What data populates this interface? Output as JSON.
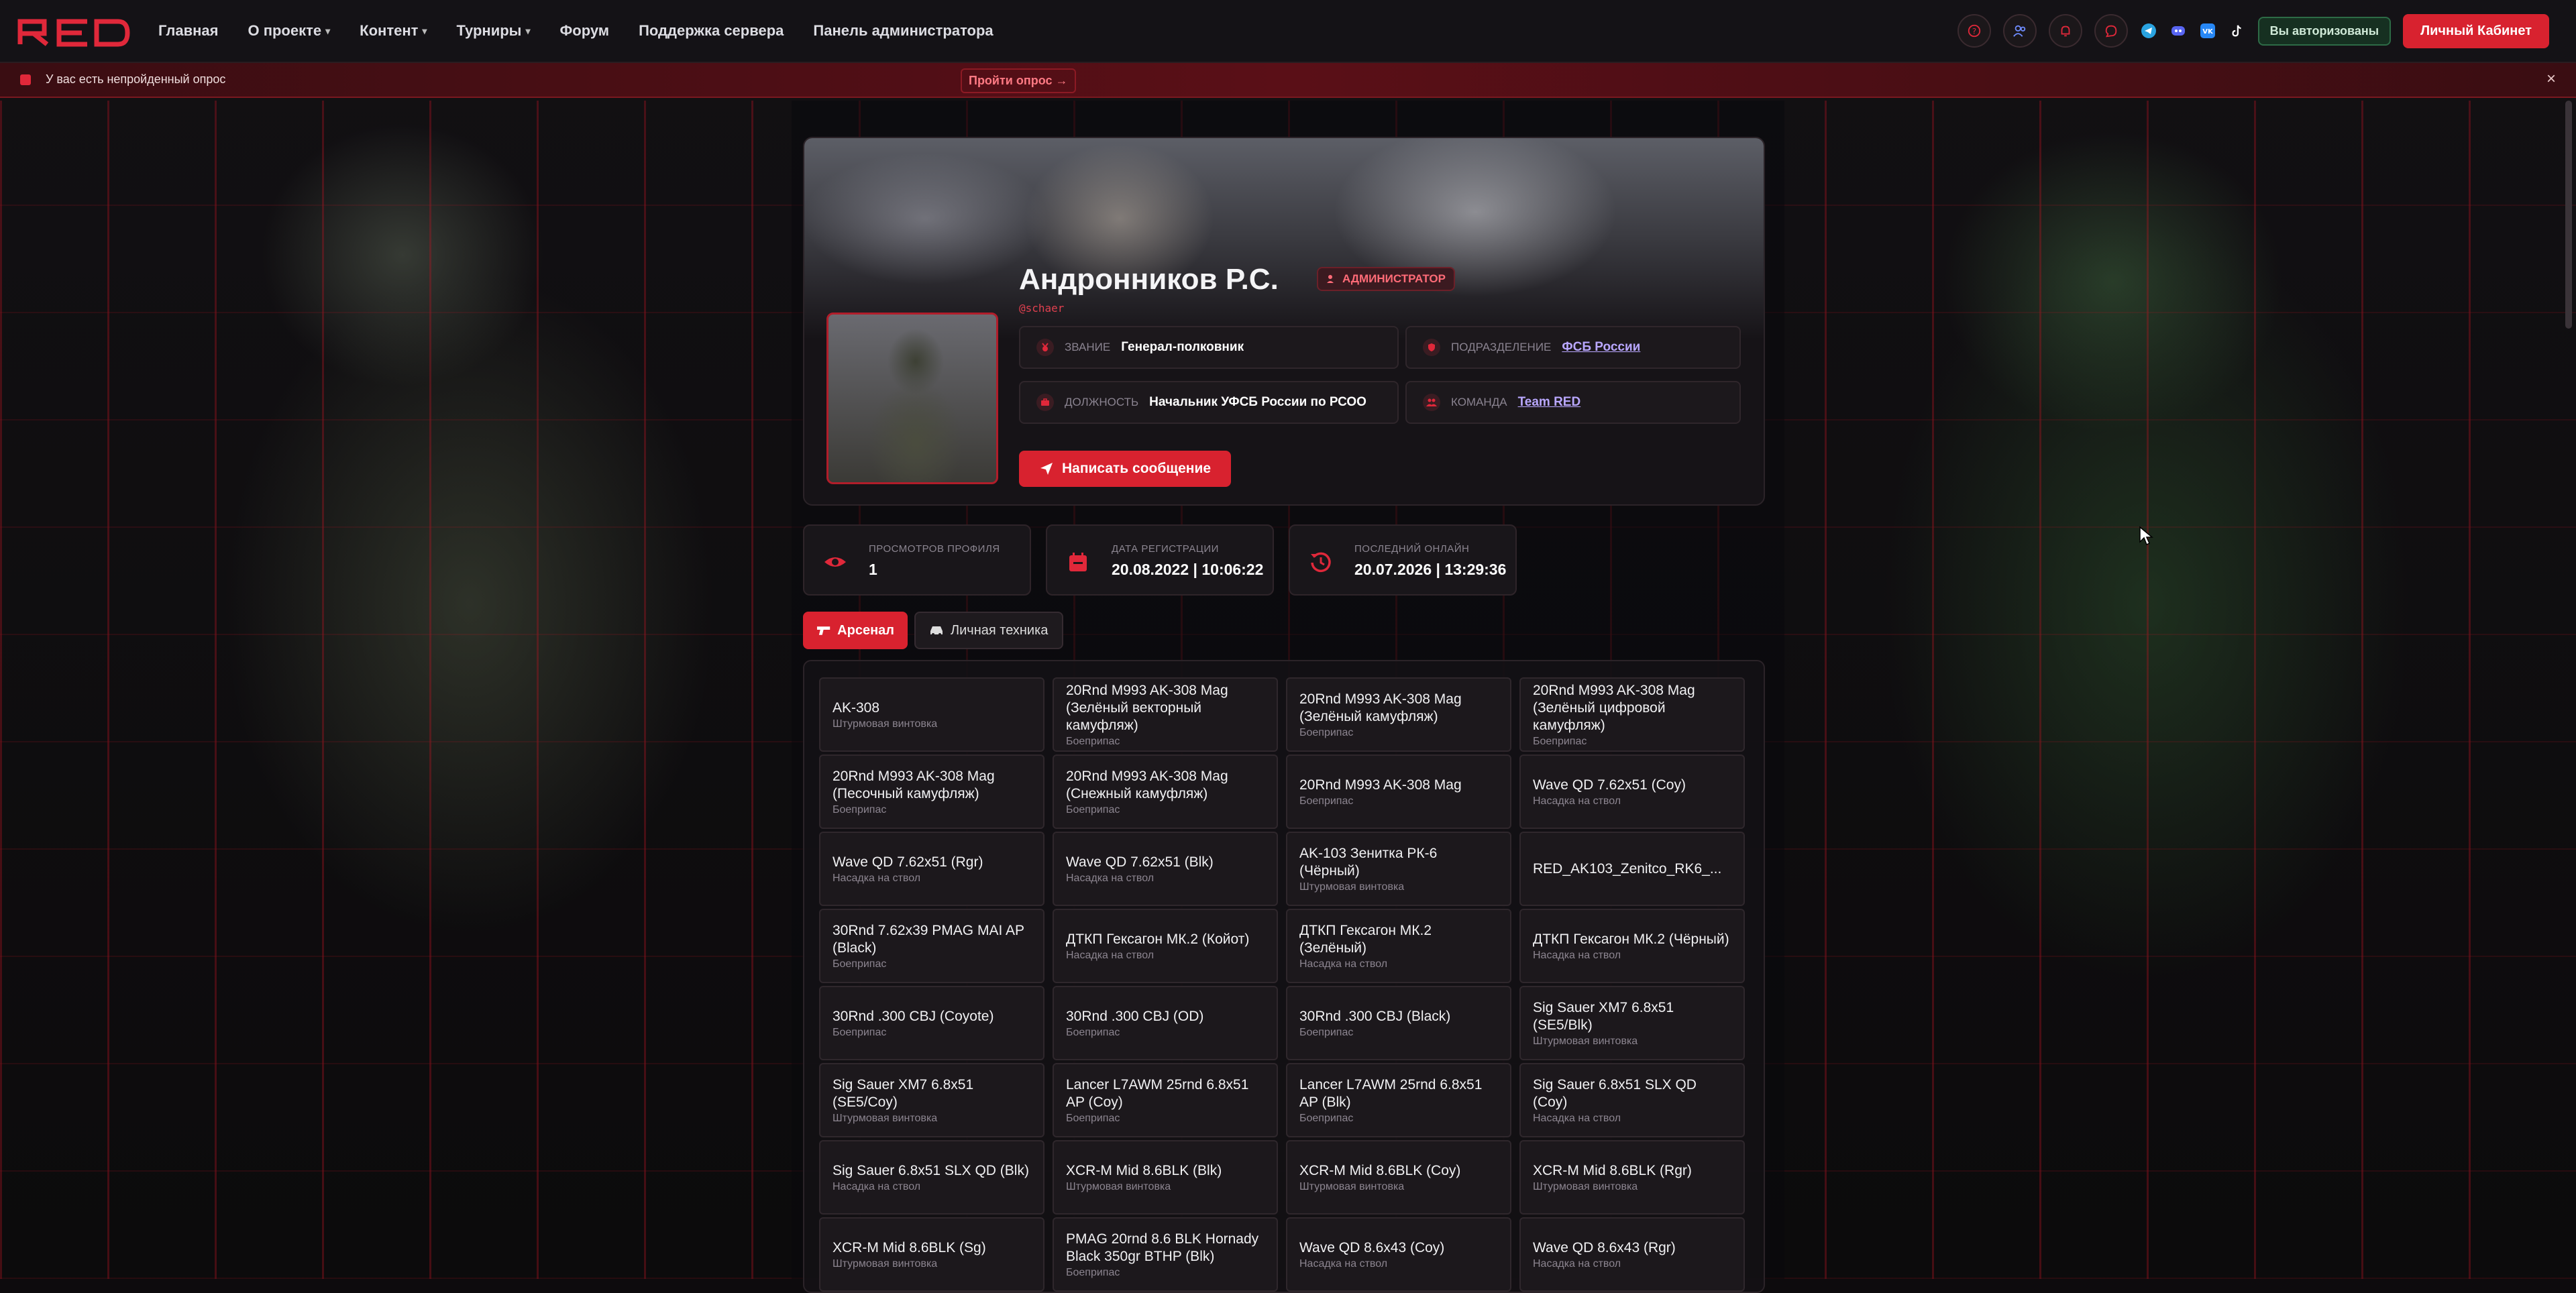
{
  "nav": {
    "logo": "RED",
    "items": [
      {
        "label": "Главная",
        "caret": false
      },
      {
        "label": "О проекте",
        "caret": true
      },
      {
        "label": "Контент",
        "caret": true
      },
      {
        "label": "Турниры",
        "caret": true
      },
      {
        "label": "Форум",
        "caret": false
      },
      {
        "label": "Поддержка сервера",
        "caret": false
      },
      {
        "label": "Панель администратора",
        "caret": false
      }
    ],
    "auth_status": "Вы авторизованы",
    "cabinet_label": "Личный Кабинет"
  },
  "alert": {
    "text": "У вас есть непройденный опрос",
    "link": "Пройти опрос →",
    "close": "×"
  },
  "profile": {
    "name": "Андронников Р.С.",
    "role": "АДМИНИСТРАТОР",
    "handle": "@schaer",
    "rank_label": "ЗВАНИЕ",
    "rank": "Генерал-полковник",
    "unit_label": "ПОДРАЗДЕЛЕНИЕ",
    "unit": "ФСБ России",
    "position_label": "ДОЛЖНОСТЬ",
    "position": "Начальник УФСБ России по РСОО",
    "team_label": "КОМАНДА",
    "team": "Team RED",
    "message_button": "Написать сообщение"
  },
  "stats": [
    {
      "label": "ПРОСМОТРОВ ПРОФИЛЯ",
      "value": "1",
      "icon": "eye-icon"
    },
    {
      "label": "ДАТА РЕГИСТРАЦИИ",
      "value": "20.08.2022 | 10:06:22",
      "icon": "calendar-icon"
    },
    {
      "label": "ПОСЛЕДНИЙ ОНЛАЙН",
      "value": "20.07.2026 | 13:29:36",
      "icon": "history-icon"
    }
  ],
  "tabs": {
    "arsenal": "Арсенал",
    "vehicles": "Личная техника"
  },
  "items": [
    {
      "name": "AK-308",
      "type": "Штурмовая винтовка"
    },
    {
      "name": "20Rnd M993 AK-308 Mag (Зелёный векторный камуфляж)",
      "type": "Боеприпас"
    },
    {
      "name": "20Rnd M993 AK-308 Mag (Зелёный камуфляж)",
      "type": "Боеприпас"
    },
    {
      "name": "20Rnd M993 AK-308 Mag (Зелёный цифровой камуфляж)",
      "type": "Боеприпас"
    },
    {
      "name": "20Rnd M993 AK-308 Mag (Песочный камуфляж)",
      "type": "Боеприпас"
    },
    {
      "name": "20Rnd M993 AK-308 Mag (Снежный камуфляж)",
      "type": "Боеприпас"
    },
    {
      "name": "20Rnd M993 AK-308 Mag",
      "type": "Боеприпас"
    },
    {
      "name": "Wave QD 7.62x51 (Coy)",
      "type": "Насадка на ствол"
    },
    {
      "name": "Wave QD 7.62x51 (Rgr)",
      "type": "Насадка на ствол"
    },
    {
      "name": "Wave QD 7.62x51 (Blk)",
      "type": "Насадка на ствол"
    },
    {
      "name": "AK-103 Зенитка РК-6 (Чёрный)",
      "type": "Штурмовая винтовка"
    },
    {
      "name": "RED_AK103_Zenitco_RK6_...",
      "type": ""
    },
    {
      "name": "30Rnd 7.62x39 PMAG MAI AP (Black)",
      "type": "Боеприпас"
    },
    {
      "name": "ДТКП Гексагон МК.2 (Койот)",
      "type": "Насадка на ствол"
    },
    {
      "name": "ДТКП Гексагон МК.2 (Зелёный)",
      "type": "Насадка на ствол"
    },
    {
      "name": "ДТКП Гексагон МК.2 (Чёрный)",
      "type": "Насадка на ствол"
    },
    {
      "name": "30Rnd .300 CBJ (Coyote)",
      "type": "Боеприпас"
    },
    {
      "name": "30Rnd .300 CBJ (OD)",
      "type": "Боеприпас"
    },
    {
      "name": "30Rnd .300 CBJ (Black)",
      "type": "Боеприпас"
    },
    {
      "name": "Sig Sauer XM7 6.8x51 (SE5/Blk)",
      "type": "Штурмовая винтовка"
    },
    {
      "name": "Sig Sauer XM7 6.8x51 (SE5/Coy)",
      "type": "Штурмовая винтовка"
    },
    {
      "name": "Lancer L7AWM 25rnd 6.8x51 AP (Coy)",
      "type": "Боеприпас"
    },
    {
      "name": "Lancer L7AWM 25rnd 6.8x51 AP (Blk)",
      "type": "Боеприпас"
    },
    {
      "name": "Sig Sauer 6.8x51 SLX QD (Coy)",
      "type": "Насадка на ствол"
    },
    {
      "name": "Sig Sauer 6.8x51 SLX QD (Blk)",
      "type": "Насадка на ствол"
    },
    {
      "name": "XCR-M Mid 8.6BLK (Blk)",
      "type": "Штурмовая винтовка"
    },
    {
      "name": "XCR-M Mid 8.6BLK (Coy)",
      "type": "Штурмовая винтовка"
    },
    {
      "name": "XCR-M Mid 8.6BLK (Rgr)",
      "type": "Штурмовая винтовка"
    },
    {
      "name": "XCR-M Mid 8.6BLK (Sg)",
      "type": "Штурмовая винтовка"
    },
    {
      "name": "PMAG 20rnd 8.6 BLK Hornady Black 350gr BTHP (Blk)",
      "type": "Боеприпас"
    },
    {
      "name": "Wave QD 8.6x43 (Coy)",
      "type": "Насадка на ствол"
    },
    {
      "name": "Wave QD 8.6x43 (Rgr)",
      "type": "Насадка на ствол"
    }
  ],
  "colors": {
    "accent": "#d8222f",
    "background": "#0d0b0d",
    "link": "#b9a7ff",
    "authorized": "#2d6b46"
  }
}
